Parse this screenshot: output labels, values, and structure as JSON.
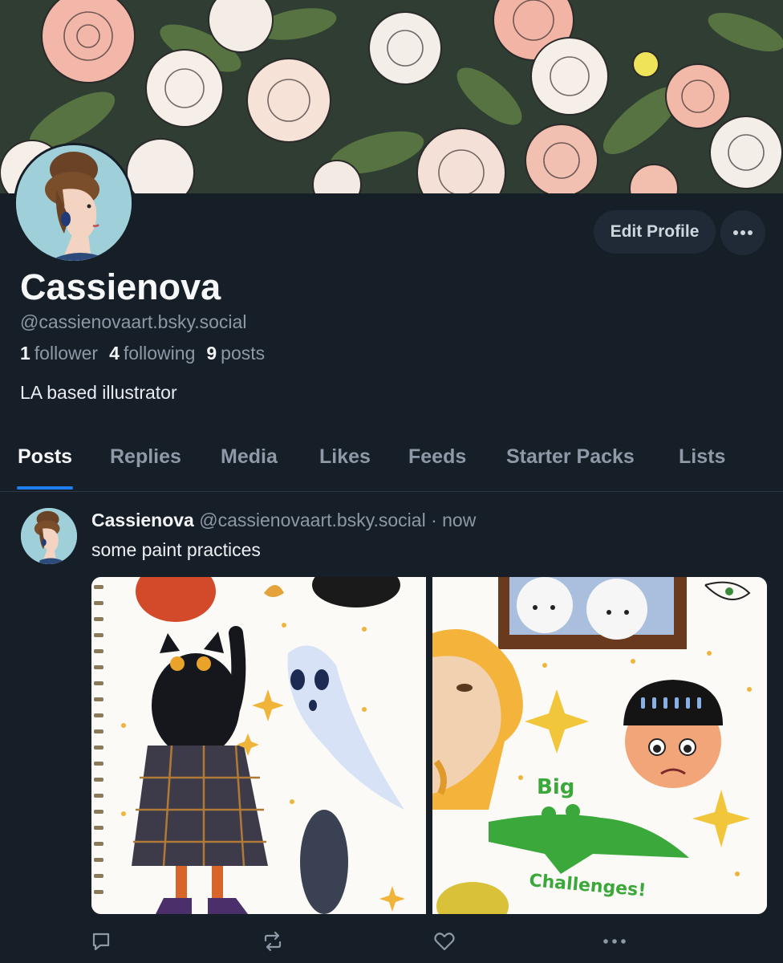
{
  "profile": {
    "display_name": "Cassienova",
    "handle": "@cassienovaart.bsky.social",
    "bio": "LA based illustrator",
    "stats": {
      "followers_count": "1",
      "followers_label": "follower",
      "following_count": "4",
      "following_label": "following",
      "posts_count": "9",
      "posts_label": "posts"
    },
    "edit_label": "Edit Profile"
  },
  "tabs": [
    "Posts",
    "Replies",
    "Media",
    "Likes",
    "Feeds",
    "Starter Packs",
    "Lists"
  ],
  "active_tab": "Posts",
  "post": {
    "author": "Cassienova",
    "handle": "@cassienovaart.bsky.social",
    "separator": "·",
    "time": "now",
    "text": "some paint practices",
    "image_text": [
      "Big",
      "Challenges!"
    ]
  },
  "icons": [
    "more-icon",
    "reply-icon",
    "repost-icon",
    "like-icon",
    "post-more-icon"
  ],
  "colors": {
    "background": "#161e27",
    "accent": "#1f7ff0",
    "muted": "#8d99a6",
    "button": "#1f2a36"
  }
}
